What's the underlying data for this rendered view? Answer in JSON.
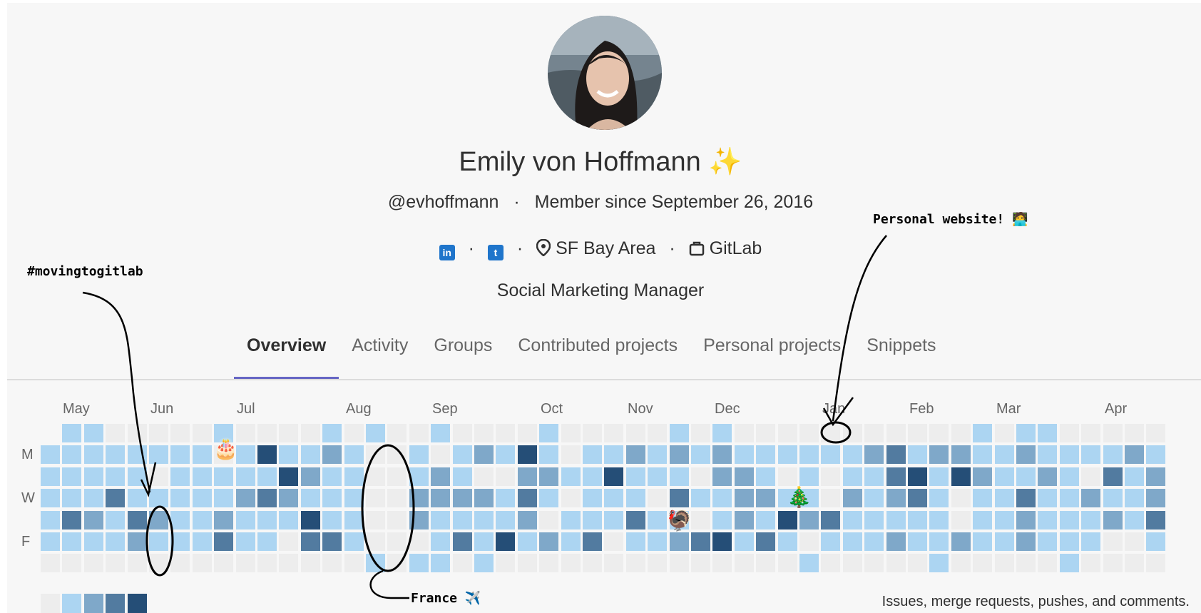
{
  "profile": {
    "name": "Emily von Hoffmann",
    "name_emoji": "✨",
    "username": "@evhoffmann",
    "member_since": "Member since September 26, 2016",
    "location": "SF Bay Area",
    "organization": "GitLab",
    "job_title": "Social Marketing Manager",
    "separator": "·"
  },
  "tabs": [
    {
      "label": "Overview",
      "active": true
    },
    {
      "label": "Activity"
    },
    {
      "label": "Groups"
    },
    {
      "label": "Contributed projects"
    },
    {
      "label": "Personal projects"
    },
    {
      "label": "Snippets"
    }
  ],
  "calendar": {
    "months": [
      "May",
      "Jun",
      "Jul",
      "Aug",
      "Sep",
      "Oct",
      "Nov",
      "Dec",
      "Jan",
      "Feb",
      "Mar",
      "Apr"
    ],
    "day_labels": [
      "M",
      "W",
      "F"
    ],
    "caption": "Issues, merge requests, pushes, and comments.",
    "colors": [
      "#ededed",
      "#acd5f2",
      "#7fa8c9",
      "#527ba0",
      "#254e77"
    ],
    "legend_levels": [
      0,
      1,
      2,
      3,
      4
    ],
    "emojis": {
      "birthday": "🎂",
      "turkey": "🦃",
      "tree": "🎄"
    }
  },
  "annotations": {
    "moving": "#movingtogitlab",
    "website": "Personal website! 🧑‍💻",
    "france": "France ✈️"
  }
}
